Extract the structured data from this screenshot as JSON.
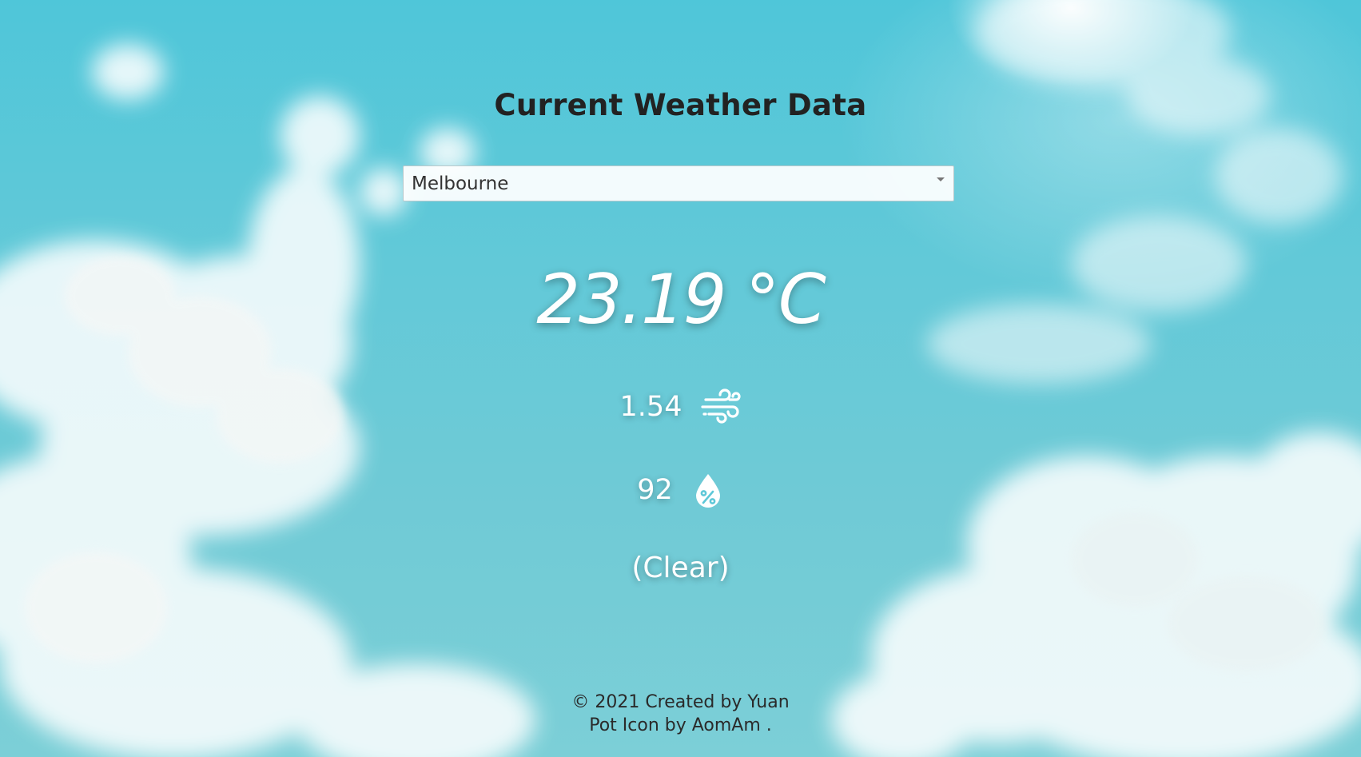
{
  "page": {
    "title": "Current Weather Data"
  },
  "city_select": {
    "selected": "Melbourne"
  },
  "weather": {
    "temperature": "23.19 °C",
    "wind_speed": "1.54",
    "humidity": "92",
    "condition": "(Clear)"
  },
  "footer": {
    "line1": "© 2021 Created by Yuan",
    "line2": "Pot Icon by AomAm ."
  },
  "icons": {
    "wind": "wind-icon",
    "humidity": "humidity-drop-icon",
    "dropdown": "chevron-down-icon"
  },
  "colors": {
    "sky": "#5fc8d8",
    "title_text": "#222222",
    "value_text": "#ffffff"
  }
}
